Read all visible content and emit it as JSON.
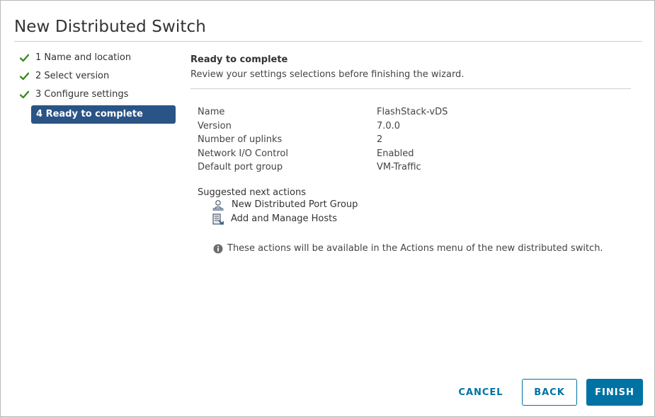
{
  "dialog": {
    "title": "New Distributed Switch"
  },
  "steps": [
    {
      "label": "1 Name and location",
      "done": true
    },
    {
      "label": "2 Select version",
      "done": true
    },
    {
      "label": "3 Configure settings",
      "done": true
    },
    {
      "label": "4 Ready to complete",
      "done": false,
      "active": true
    }
  ],
  "content": {
    "heading": "Ready to complete",
    "subheading": "Review your settings selections before finishing the wizard."
  },
  "summary": [
    {
      "key": "Name",
      "value": "FlashStack-vDS"
    },
    {
      "key": "Version",
      "value": "7.0.0"
    },
    {
      "key": "Number of uplinks",
      "value": "2"
    },
    {
      "key": "Network I/O Control",
      "value": "Enabled"
    },
    {
      "key": "Default port group",
      "value": "VM-Traffic"
    }
  ],
  "suggested": {
    "heading": "Suggested next actions",
    "actions": [
      {
        "label": "New Distributed Port Group",
        "icon": "port-group-icon"
      },
      {
        "label": "Add and Manage Hosts",
        "icon": "manage-hosts-icon"
      }
    ],
    "info": "These actions will be available in the Actions menu of the new distributed switch."
  },
  "footer": {
    "cancel": "CANCEL",
    "back": "BACK",
    "finish": "FINISH"
  },
  "colors": {
    "accent": "#0072a3",
    "active_step": "#2a5486",
    "check": "#3c8d1f"
  }
}
